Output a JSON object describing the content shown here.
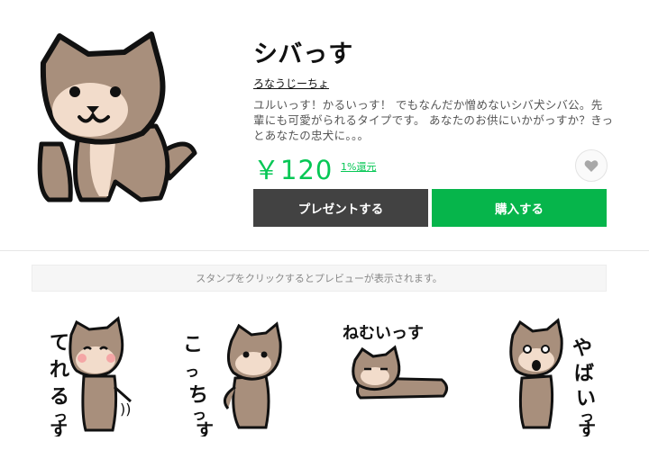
{
  "product": {
    "title": "シバっす",
    "author": "ろなうじーちょ",
    "description": "ユルいっす！かるいっす！ でもなんだか憎めないシバ犬シバ公。先輩にも可愛がられるタイプです。 あなたのお供にいかがっすか？きっとあなたの忠犬に。。。",
    "price": "￥120",
    "rebate": "1%還元"
  },
  "buttons": {
    "gift": "プレゼントする",
    "buy": "購入する"
  },
  "hint": "スタンプをクリックするとプレビューが表示されます。",
  "stickers": [
    {
      "caption": "てれるっす",
      "icon": "shiba-blush-sticker"
    },
    {
      "caption": "こっちっす",
      "icon": "shiba-beckon-sticker"
    },
    {
      "caption": "ねむいっす",
      "icon": "shiba-sleep-sticker"
    },
    {
      "caption": "やばいっす",
      "icon": "shiba-panic-sticker"
    }
  ],
  "colors": {
    "accent": "#06c755",
    "buy": "#06b54b",
    "gift": "#424242",
    "fur": "#a88f7c",
    "muzzle": "#f2dccb"
  }
}
